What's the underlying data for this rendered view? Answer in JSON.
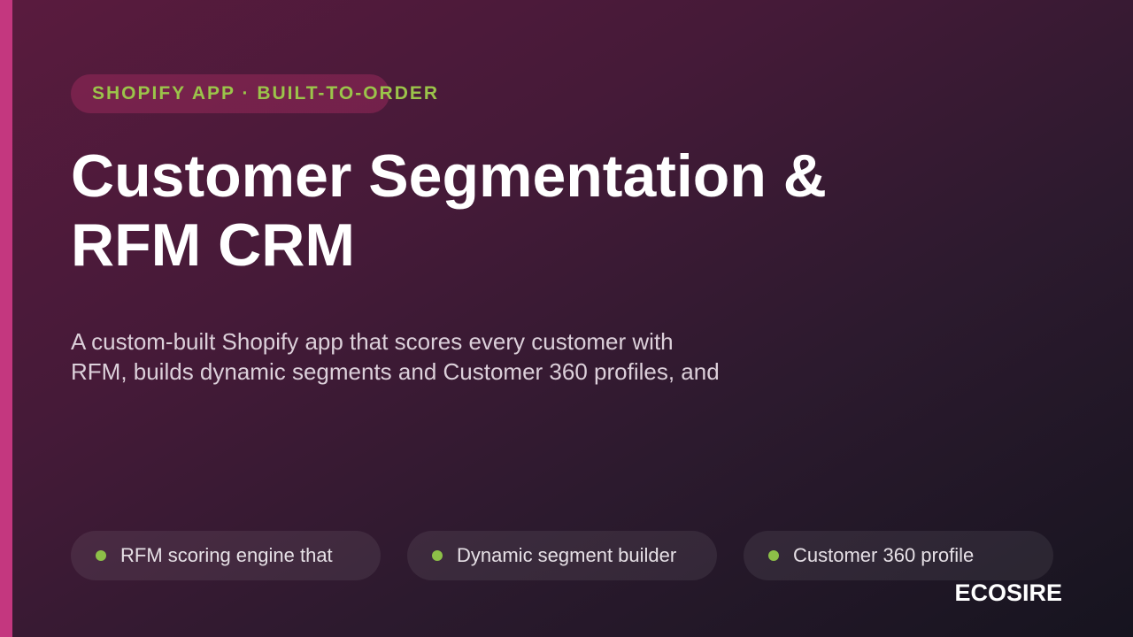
{
  "colors": {
    "accent_bar": "#c4377f",
    "eyebrow_text": "#9bc44a",
    "bullet": "#8dc048"
  },
  "eyebrow": {
    "label": "SHOPIFY APP · BUILT-TO-ORDER"
  },
  "hero": {
    "title_line1": "Customer Segmentation &",
    "title_line2": "RFM CRM",
    "subtitle_line1": "A custom-built Shopify app that scores every customer with",
    "subtitle_line2": "RFM, builds dynamic segments and Customer 360 profiles, and"
  },
  "features": [
    {
      "label": "RFM scoring engine that",
      "icon": "bullet-dot-icon"
    },
    {
      "label": "Dynamic segment builder",
      "icon": "bullet-dot-icon"
    },
    {
      "label": "Customer 360 profile",
      "icon": "bullet-dot-icon"
    }
  ],
  "brand": {
    "name": "ECOSIRE"
  }
}
